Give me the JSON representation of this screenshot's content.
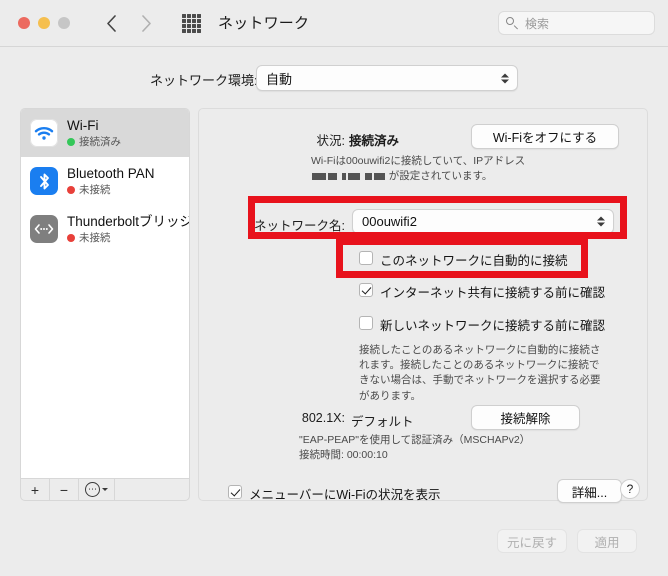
{
  "window": {
    "title": "ネットワーク",
    "traffic_lights": [
      "close",
      "minimize",
      "zoom"
    ],
    "back_icon": "chevron-left-icon",
    "forward_icon": "chevron-right-icon",
    "grid_icon": "grid-apps-icon"
  },
  "search": {
    "placeholder": "検索",
    "value": "",
    "icon": "search-icon"
  },
  "location": {
    "label": "ネットワーク環境:",
    "value": "自動",
    "options": [
      "自動"
    ]
  },
  "sidebar": {
    "items": [
      {
        "name": "Wi-Fi",
        "status": "接続済み",
        "status_color": "#34c759",
        "icon": "wifi-icon",
        "selected": true
      },
      {
        "name": "Bluetooth PAN",
        "status": "未接続",
        "status_color": "#e8403a",
        "icon": "bluetooth-icon",
        "selected": false
      },
      {
        "name": "Thunderboltブリッジ",
        "status": "未接続",
        "status_color": "#e8403a",
        "icon": "thunderbolt-icon",
        "selected": false
      }
    ],
    "footer": {
      "add_label": "+",
      "remove_label": "−",
      "action_label": "⋯",
      "action_icon": "gear-circle-icon",
      "chevron_icon": "chevron-down-icon"
    }
  },
  "detail": {
    "status_label": "状況:",
    "status_value": "接続済み",
    "power_button": "Wi-Fiをオフにする",
    "status_desc_line1": "Wi-Fiは00ouwifi2に接続していて、IPアドレス",
    "status_desc_line2_suffix": "が設定されています。",
    "network_name_label": "ネットワーク名:",
    "network_name_value": "00ouwifi2",
    "auto_join_label": "このネットワークに自動的に接続",
    "auto_join_checked": false,
    "ask_hotspot_label": "インターネット共有に接続する前に確認",
    "ask_hotspot_checked": true,
    "ask_new_networks_label": "新しいネットワークに接続する前に確認",
    "ask_new_networks_checked": false,
    "help_text": "接続したことのあるネットワークに自動的に接続されます。接続したことのあるネットワークに接続できない場合は、手動でネットワークを選択する必要があります。",
    "dot1x_label": "802.1X:",
    "dot1x_value": "デフォルト",
    "disconnect_button": "接続解除",
    "auth_line": "\"EAP-PEAP\"を使用して認証済み（MSCHAPv2）",
    "conn_time_line": "接続時間: 00:00:10",
    "menubar_label": "メニューバーにWi-Fiの状況を表示",
    "menubar_checked": true,
    "advanced_button": "詳細...",
    "help_button": "?"
  },
  "footer": {
    "revert_button": "元に戻す",
    "apply_button": "適用",
    "revert_enabled": false,
    "apply_enabled": false
  },
  "annotations": {
    "accent_color": "#e8121c",
    "box1_target": "ネットワーク名: 00ouwifi2",
    "box2_target": "このネットワークに自動的に接続"
  }
}
